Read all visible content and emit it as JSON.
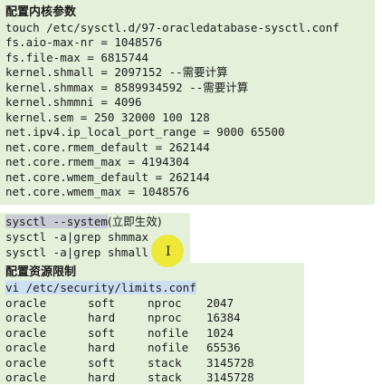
{
  "section1": {
    "title": "配置内核参数",
    "lines": [
      "touch /etc/sysctl.d/97-oracledatabase-sysctl.conf",
      "fs.aio-max-nr = 1048576",
      "fs.file-max = 6815744",
      "kernel.shmall = 2097152 --",
      "kernel.shmmax = 8589934592 --",
      "kernel.shmmni = 4096",
      "kernel.sem = 250 32000 100 128",
      "net.ipv4.ip_local_port_range = 9000 65500",
      "net.core.rmem_default = 262144",
      "net.core.rmem_max = 4194304",
      "net.core.wmem_default = 262144",
      "net.core.wmem_max = 1048576"
    ],
    "shmall_note": "需要计算",
    "shmmax_note": "需要计算"
  },
  "section2": {
    "cmd_highlight": "sysctl --system",
    "cmd_note": "(立即生效)",
    "grep_lines": [
      "sysctl -a|grep shmmax",
      "sysctl -a|grep shmall"
    ]
  },
  "section3": {
    "title": "配置资源限制",
    "cmd": "vi /etc/security/limits.conf",
    "limits": [
      [
        "oracle",
        "soft",
        "nproc",
        "2047"
      ],
      [
        "oracle",
        "hard",
        "nproc",
        "16384"
      ],
      [
        "oracle",
        "soft",
        "nofile",
        "1024"
      ],
      [
        "oracle",
        "hard",
        "nofile",
        "65536"
      ],
      [
        "oracle",
        "soft",
        "stack",
        "3145728"
      ],
      [
        "oracle",
        "hard",
        "stack",
        "3145728"
      ]
    ]
  },
  "cursor_icon": "text-cursor-icon",
  "colors": {
    "panel": "#e4f0da",
    "highlight_gray": "#c9ccd6",
    "highlight_blue": "#cddff2",
    "cursor_dot": "#eee828"
  }
}
